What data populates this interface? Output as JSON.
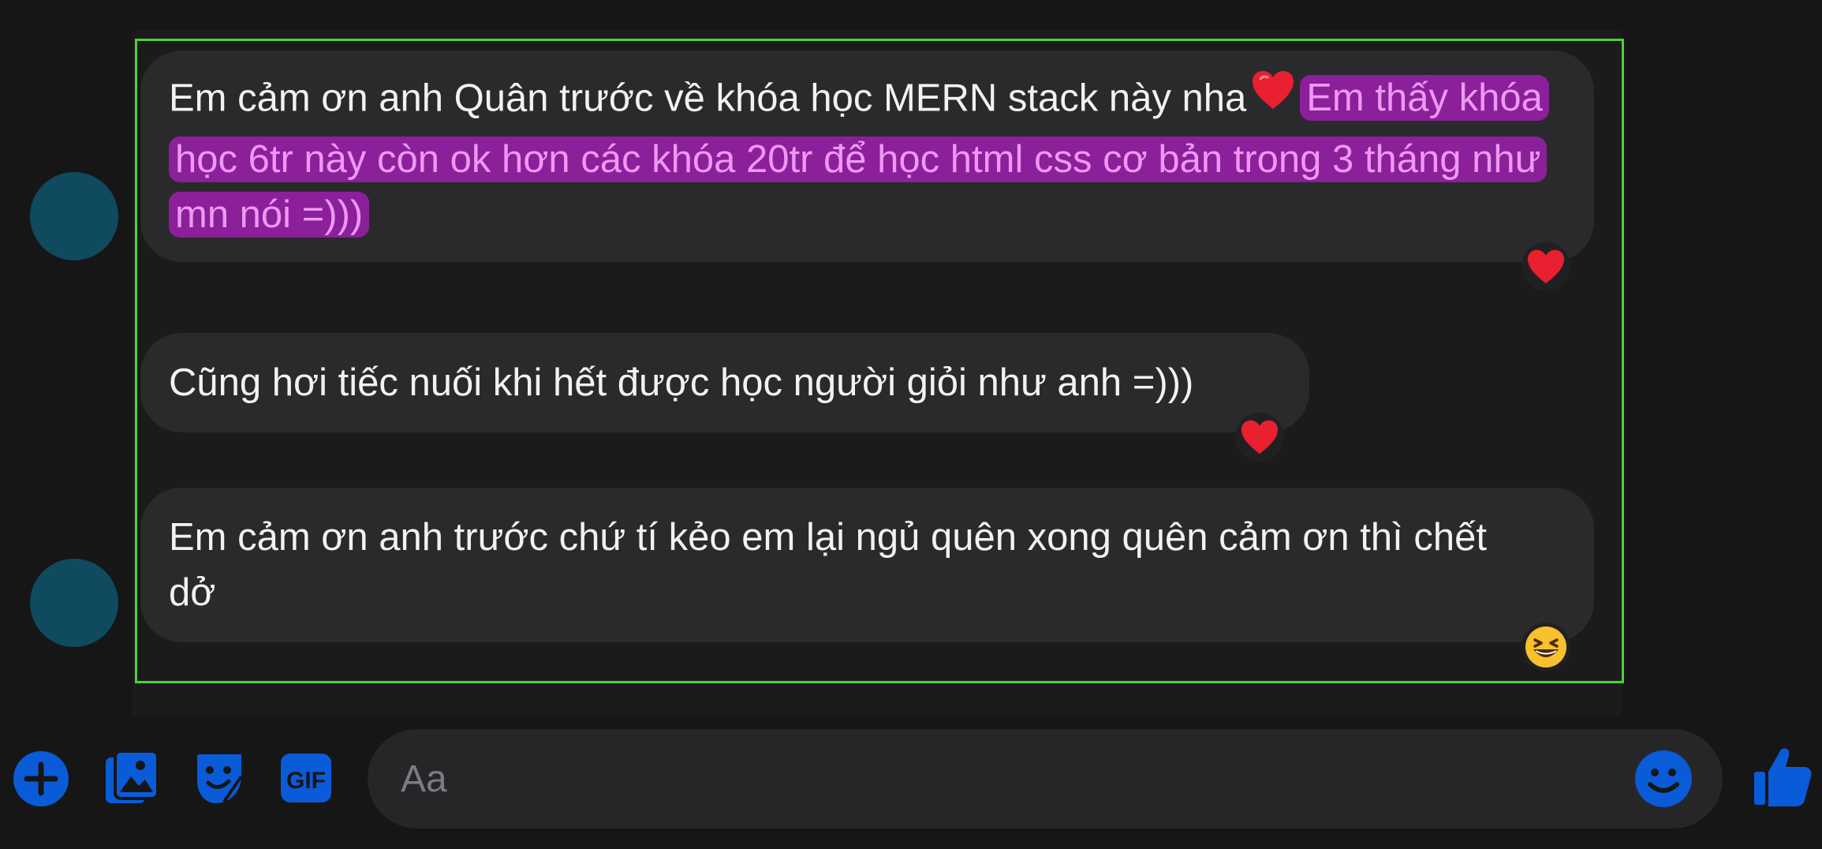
{
  "messages": [
    {
      "text_part1": "Em cảm ơn anh Quân trước về khóa học MERN stack này nha",
      "highlighted": "Em thấy khóa học 6tr này còn ok hơn các khóa 20tr để học html css cơ bản trong 3 tháng như mn nói =)))",
      "reaction": "heart"
    },
    {
      "text": "Cũng hơi tiếc nuối khi hết được học người giỏi như anh =)))",
      "reaction": "heart"
    },
    {
      "text": "Em cảm ơn anh trước chứ tí kẻo em lại ngủ quên xong quên cảm ơn thì chết dở",
      "reaction": "laughing"
    }
  ],
  "composer": {
    "placeholder": "Aa",
    "tools": [
      "plus-icon",
      "image-icon",
      "sticker-icon",
      "gif-icon"
    ],
    "gif_label": "GIF",
    "send": "like-icon"
  },
  "colors": {
    "background": "#161616",
    "bubble": "#2a2a2c",
    "highlight_bg": "#8c1f9a",
    "highlight_text": "#ee98f5",
    "accent": "#0a5bd8",
    "selection": "#4cd137",
    "avatar": "#0f4a5f"
  }
}
